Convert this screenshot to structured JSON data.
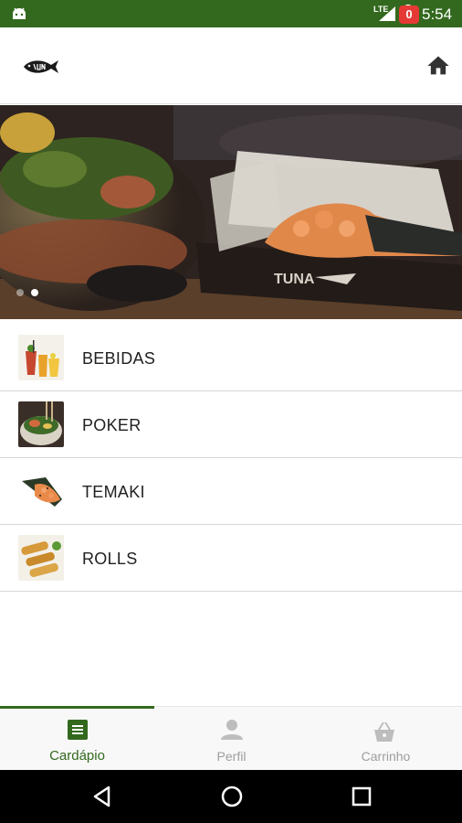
{
  "status_bar": {
    "network": "LTE",
    "time": "5:54"
  },
  "toolbar": {
    "logo_icon": "tuna-fish-logo",
    "home_icon": "home-icon"
  },
  "banner": {
    "slide_count": 2,
    "active_slide": 2
  },
  "categories": [
    {
      "label": "BEBIDAS",
      "thumb": "drinks-thumbnail"
    },
    {
      "label": "POKER",
      "thumb": "poke-bowl-thumbnail"
    },
    {
      "label": "TEMAKI",
      "thumb": "temaki-thumbnail"
    },
    {
      "label": "ROLLS",
      "thumb": "spring-rolls-thumbnail"
    }
  ],
  "bottom_nav": {
    "items": [
      {
        "label": "Cardápio",
        "icon": "menu-list-icon",
        "selected": true
      },
      {
        "label": "Perfil",
        "icon": "person-icon",
        "selected": false
      },
      {
        "label": "Carrinho",
        "icon": "basket-icon",
        "selected": false
      }
    ],
    "cart_count": "0"
  },
  "colors": {
    "primary": "#33691e",
    "badge": "#e53935",
    "inactive": "#9e9e9e"
  }
}
